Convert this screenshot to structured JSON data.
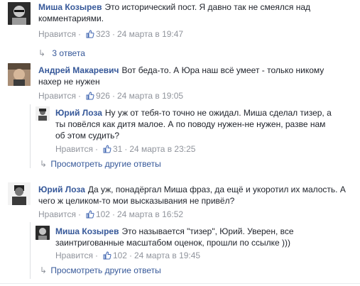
{
  "comments": [
    {
      "author": "Миша Козырев",
      "lines": [
        "Это исторический пост. Я давно так не смеялся над",
        "комментариями."
      ],
      "like_label": "Нравится",
      "likes": "323",
      "time": "24 марта в 19:47"
    },
    {
      "author": "Андрей Макаревич",
      "lines": [
        "Вот беда-то. А Юра наш всё умеет - только никому",
        "нахер не нужен"
      ],
      "like_label": "Нравится",
      "likes": "926",
      "time": "24 марта в 19:05"
    },
    {
      "author": "Юрий Лоза",
      "lines": [
        "Ну уж от тебя-то точно не ожидал. Миша сделал тизер, а",
        "ты повёлся как дитя малое. А по поводу нужен-не нужен, разве нам",
        "об этом судить?"
      ],
      "like_label": "Нравится",
      "likes": "31",
      "time": "24 марта в 23:25"
    },
    {
      "author": "Юрий Лоза",
      "lines": [
        "Да уж, понадёргал Миша фраз, да ещё и укоротил их малость. А",
        "чего ж целиком-то мои высказывания не привёл?"
      ],
      "like_label": "Нравится",
      "likes": "102",
      "time": "24 марта в 16:52"
    },
    {
      "author": "Миша Козырев",
      "lines": [
        "Это называется \"тизер\", Юрий. Уверен, все",
        "заинтригованные масштабом оценок, прошли по ссылке )))"
      ],
      "like_label": "Нравится",
      "likes": "102",
      "time": "24 марта в 19:45"
    }
  ],
  "replies_link_1": "3 ответа",
  "more_replies_1": "Просмотреть другие ответы",
  "more_replies_2": "Просмотреть другие ответы",
  "separator": "·",
  "colors": {
    "link": "#365899",
    "meta": "#90949c",
    "text": "#1d2129"
  }
}
